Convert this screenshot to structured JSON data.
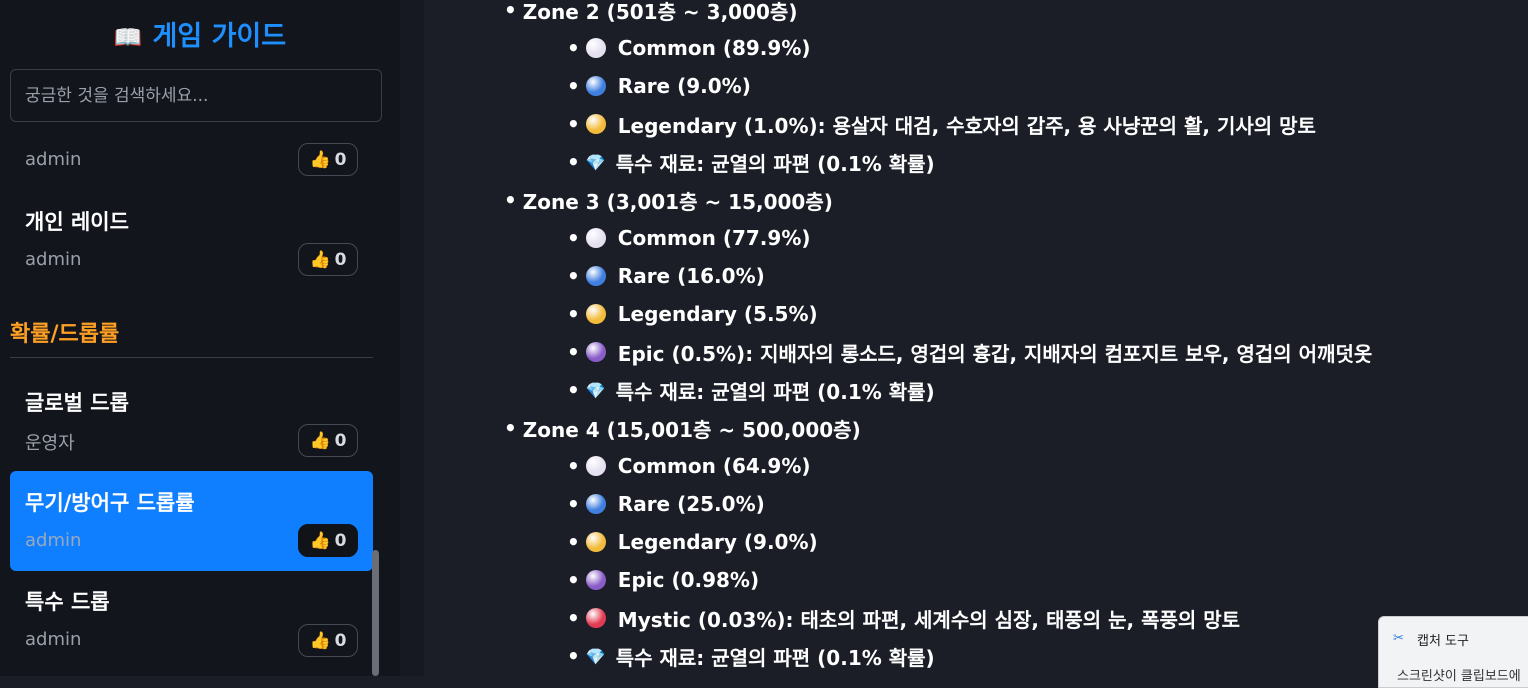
{
  "sidebar": {
    "brand_icon": "📖",
    "brand_title": "게임 가이드",
    "search_placeholder": "궁금한 것을 검색하세요...",
    "section_title": "확률/드롭률",
    "guides": [
      {
        "title": "",
        "author": "admin",
        "likes": "0",
        "active": false
      },
      {
        "title": "개인 레이드",
        "author": "admin",
        "likes": "0",
        "active": false
      },
      {
        "title": "글로벌 드롭",
        "author": "운영자",
        "likes": "0",
        "active": false
      },
      {
        "title": "무기/방어구 드롭률",
        "author": "admin",
        "likes": "0",
        "active": true
      },
      {
        "title": "특수 드롭",
        "author": "admin",
        "likes": "0",
        "active": false
      }
    ],
    "like_icon": "👍"
  },
  "content": {
    "rows": [
      {
        "type": "zone",
        "text": "Zone 2 (501층 ~ 3,000층)"
      },
      {
        "type": "item",
        "icon": "common",
        "text": "Common (89.9%)"
      },
      {
        "type": "item",
        "icon": "rare",
        "text": "Rare (9.0%)"
      },
      {
        "type": "item",
        "icon": "legendary",
        "text": "Legendary (1.0%): 용살자 대검, 수호자의 갑주, 용 사냥꾼의 활, 기사의 망토"
      },
      {
        "type": "item",
        "icon": "gem",
        "text": "특수 재료: 균열의 파편 (0.1% 확률)"
      },
      {
        "type": "zone",
        "text": "Zone 3 (3,001층 ~ 15,000층)"
      },
      {
        "type": "item",
        "icon": "common",
        "text": "Common (77.9%)"
      },
      {
        "type": "item",
        "icon": "rare",
        "text": "Rare (16.0%)"
      },
      {
        "type": "item",
        "icon": "legendary",
        "text": "Legendary (5.5%)"
      },
      {
        "type": "item",
        "icon": "epic",
        "text": "Epic (0.5%): 지배자의 롱소드, 영겁의 흉갑, 지배자의 컴포지트 보우, 영겁의 어깨덧옷"
      },
      {
        "type": "item",
        "icon": "gem",
        "text": "특수 재료: 균열의 파편 (0.1% 확률)"
      },
      {
        "type": "zone",
        "text": "Zone 4 (15,001층 ~ 500,000층)"
      },
      {
        "type": "item",
        "icon": "common",
        "text": "Common (64.9%)"
      },
      {
        "type": "item",
        "icon": "rare",
        "text": "Rare (25.0%)"
      },
      {
        "type": "item",
        "icon": "legendary",
        "text": "Legendary (9.0%)"
      },
      {
        "type": "item",
        "icon": "epic",
        "text": "Epic (0.98%)"
      },
      {
        "type": "item",
        "icon": "mystic",
        "text": "Mystic (0.03%): 태초의 파편, 세계수의 심장, 태풍의 눈, 폭풍의 망토"
      },
      {
        "type": "item",
        "icon": "gem",
        "text": "특수 재료: 균열의 파편 (0.1% 확률)"
      }
    ],
    "bullet": "•",
    "rarity_colors": {
      "common": "#e4e0f0",
      "rare": "#3f7fe0",
      "legendary": "#f2bb3a",
      "epic": "#8a5cc8",
      "mystic": "#e23c54"
    },
    "gem_icon": "💎"
  },
  "snipping_tool": {
    "title": "캡처 도구",
    "message": "스크린샷이 클립보드에"
  }
}
